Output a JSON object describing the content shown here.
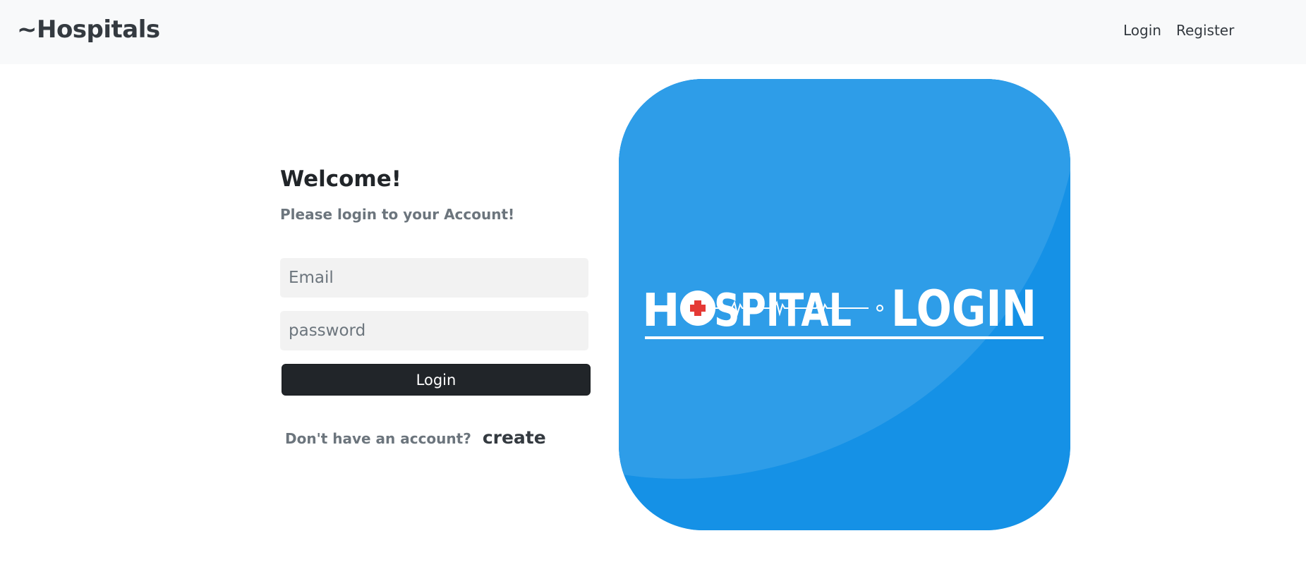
{
  "navbar": {
    "brand": "~Hospitals",
    "links": [
      "Login",
      "Register"
    ]
  },
  "login": {
    "welcome": "Welcome!",
    "subtitle": "Please login to your Account!",
    "email_placeholder": "Email",
    "email_value": "",
    "password_placeholder": "password",
    "password_value": "",
    "submit_label": "Login",
    "signup_prompt": "Don't have an account?",
    "signup_link": "create"
  },
  "hero": {
    "logo_text_left": "H",
    "logo_text_middle": "SPITAL",
    "logo_text_right": "LOGIN",
    "background_color": "#1591e6",
    "highlight_color": "#2e9de8",
    "cross_color": "#e53935"
  },
  "colors": {
    "navbar_bg": "#f8f9fa",
    "button_bg": "#212529",
    "input_bg": "#f2f2f2",
    "muted_text": "#6c757d"
  }
}
